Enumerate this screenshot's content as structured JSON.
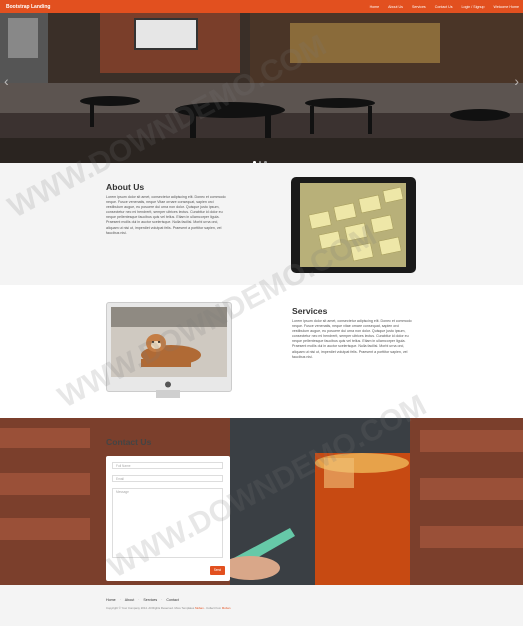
{
  "navbar": {
    "brand": "Bootstrap Landing",
    "items": [
      "Home",
      "About Us",
      "Services",
      "Contact Us",
      "Login / Signup",
      "Welcome Home"
    ]
  },
  "hero": {
    "slides": 3,
    "active": 0
  },
  "about": {
    "title": "About Us",
    "body": "Lorem ipsum dolor sit amet, consectetur adipiscing elit. Donec et commodo neque. Fusce venenatis, neque Vitae ornare consequat, sapien orci vestibulum augue, eu posuere dui urna non dolor. Quisque justo ipsum, consectetur nec mi hendrerit, semper ultrices lectus. Curabitur id dolor eu neque pellentesque faucibus quis vel tellus. Etiam in ullamcorper ligula. Praesent mollis dui in auctor scelerisque. Nulla facilisi. Morbi urna orci, aliquam ut nisi ut, imperdiet volutpat felis. Praesent a porttitor sapien, vel faucibus nisi."
  },
  "services": {
    "title": "Services",
    "body": "Lorem ipsum dolor sit amet, consectetur adipiscing elit. Donec et commodo neque. Fusce venenatis, neque vitae ornare consequat, sapien orci vestibulum augue, eu posuere dui urna non dolor. Quisque justo ipsum, consectetur nec mi hendrerit, semper ultrices lectus. Curabitur id dolor eu neque pellentesque faucibus quis vel tellus. Etiam in ullamcorper ligula. Praesent mollis dui in auctor scelerisque. Nulla facilisi. Morbi urna orci, aliquam ut nisi ut, imperdiet volutpat felis. Praesent a porttitor sapien, vel faucibus nisi."
  },
  "contact": {
    "title": "Contact Us",
    "name_placeholder": "Full Name",
    "email_placeholder": "Email",
    "message_placeholder": "Message",
    "send_label": "Send"
  },
  "footer": {
    "links": [
      "Home",
      "About",
      "Services",
      "Contact"
    ],
    "copyright": "Copyright © Your Company 2014. All Rights Reserved. More Templates",
    "copyright_link_1": "Moban",
    "copyright_mid": " - Collect from",
    "copyright_link_2": "Moban"
  },
  "watermark": "WWW.DOWNDEMO.COM",
  "colors": {
    "accent": "#e2501f",
    "section_gray": "#f4f4f4"
  }
}
